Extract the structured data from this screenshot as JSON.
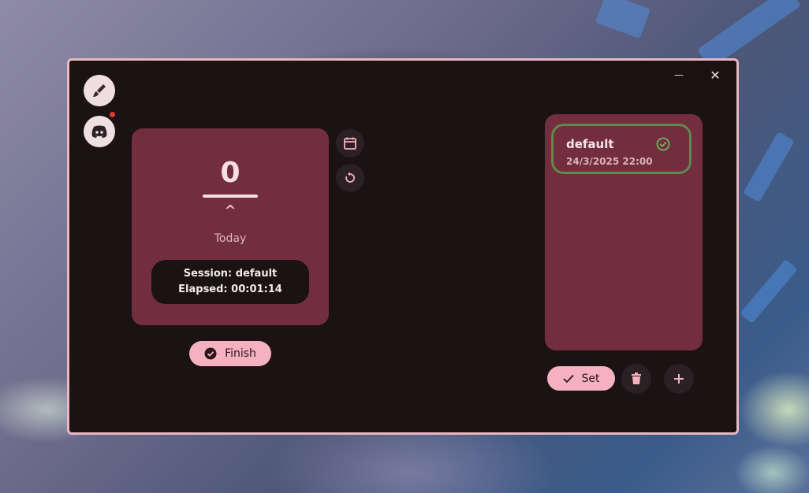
{
  "window": {
    "minimize_label": "—",
    "close_label": "✕"
  },
  "sidebar": {
    "items": [
      {
        "icon": "brush-icon"
      },
      {
        "icon": "discord-icon",
        "notification": true
      }
    ]
  },
  "counter": {
    "value": "0",
    "caret": "^",
    "period_label": "Today",
    "session_line": "Session: default",
    "elapsed_line": "Elapsed: 00:01:14"
  },
  "counter_tools": [
    {
      "icon": "calendar-icon"
    },
    {
      "icon": "reset-icon"
    }
  ],
  "finish_button": {
    "label": "Finish",
    "icon": "check-circle-icon"
  },
  "sessions": {
    "items": [
      {
        "name": "default",
        "date": "24/3/2025 22:00",
        "active": true
      }
    ]
  },
  "session_actions": {
    "set_label": "Set",
    "delete_icon": "trash-icon",
    "add_icon": "plus-icon"
  },
  "colors": {
    "window_bg": "#1b1214",
    "card_bg": "#722d3e",
    "accent_pink": "#f5b1bf",
    "active_border": "#5e8a4e",
    "window_border": "#e9b8c0"
  }
}
